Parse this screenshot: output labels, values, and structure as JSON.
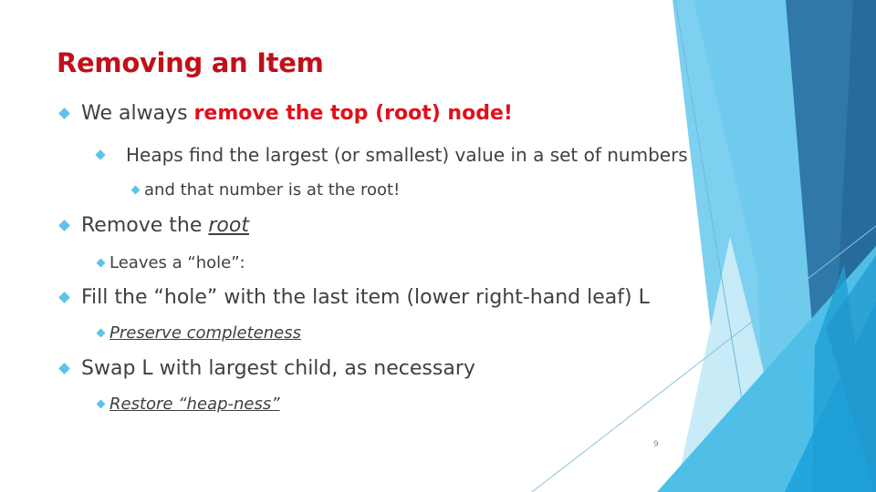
{
  "slide": {
    "title": "Removing an Item",
    "page_number": "9",
    "bullets": [
      {
        "prefix": "We always ",
        "emphasis": "remove the top (root) node!",
        "children": [
          {
            "text": "Heaps find the largest (or smallest) value in a set of numbers",
            "children": [
              {
                "text": "and that number is at the root!"
              }
            ]
          }
        ]
      },
      {
        "prefix": "Remove the ",
        "emphasis": "root",
        "children": [
          {
            "text": "Leaves a “hole”:"
          }
        ]
      },
      {
        "text": "Fill the “hole” with the last item (lower right-hand leaf) L",
        "children": [
          {
            "text": "Preserve completeness"
          }
        ]
      },
      {
        "text": "Swap L with largest child, as necessary",
        "children": [
          {
            "text": "Restore “heap-ness”"
          }
        ]
      }
    ]
  },
  "theme": {
    "title_color": "#c0101a",
    "emphasis_color": "#e0101a",
    "bullet_color": "#5bc3e8",
    "body_text_color": "#404040"
  }
}
